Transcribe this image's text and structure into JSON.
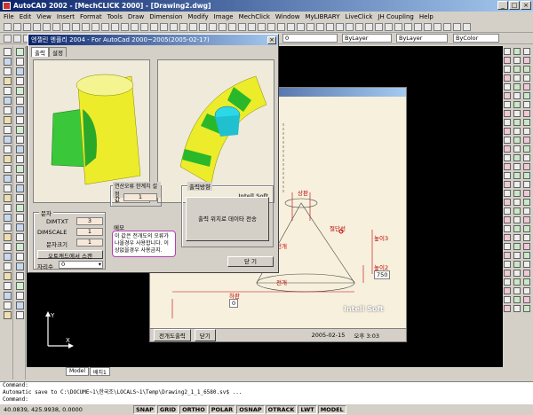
{
  "window": {
    "title": "AutoCAD 2002 - [MechCLICK 2000] - [Drawing2.dwg]"
  },
  "menu": [
    "File",
    "Edit",
    "View",
    "Insert",
    "Format",
    "Tools",
    "Draw",
    "Dimension",
    "Modify",
    "Image",
    "MechClick",
    "Window",
    "MyLIBRARY",
    "LiveClick",
    "JH Coupling",
    "Help"
  ],
  "toolbar": {
    "layer_value": "0",
    "color_value": "ByLayer",
    "linetype_value": "ByLayer",
    "lineweight_value": "ByColor"
  },
  "dialog": {
    "title": "엔젤린 엔플리 2004 - For AutoCad 2000~2005(2005-02-17)",
    "tabs": [
      "출력",
      "설정"
    ],
    "brand1": "Intell Soft",
    "brand2": "Intell Soft",
    "dim_group": "문자",
    "dimtxt_label": "DIMTXT",
    "dimtxt_value": "3",
    "dimscale_label": "DIMSCALE",
    "dimscale_value": "1",
    "textsize_label": "문자크기",
    "textsize_value": "1",
    "autocad_button": "오토캐드에서 스캔",
    "decimal_label": "자리수",
    "decimal_value": "0",
    "limit_group": "연산오류 한계치 설정",
    "limit_label": "값",
    "limit_value": "1",
    "memo_group": "메모",
    "memo_text": "이 값은 전개도의 오류가 나올경우 사용합니다. 이상없을경우 사용금지.",
    "output_group": "출력방향",
    "output_button": "출력 위치로 데이타 전송",
    "close_button": "닫 기"
  },
  "bgwindow": {
    "labels": {
      "half": "높이2",
      "dim_a": "높이3",
      "dim_b": "높이2",
      "dim_c": "하판",
      "cut_label": "절단선",
      "unfold1": "전개",
      "unfold2": "전개",
      "top": "상판"
    },
    "values": {
      "v1": "750",
      "v2": "0",
      "v3": "0"
    },
    "brand": "Intell Soft",
    "footer_btn1": "전개도출력",
    "footer_btn2": "닫기",
    "date": "2005-02-15",
    "time": "오후 3:03"
  },
  "model_tabs": [
    "Model",
    "배치1"
  ],
  "command": {
    "line1": "Command:",
    "line2": "Automatic save to C:\\DOCUME~1\\한국조\\LOCALS~1\\Temp\\Drawing2_1_1_6580.sv$ ...",
    "line3": "Command:"
  },
  "status": {
    "coords": "40.0839, 425.9938, 0.0000",
    "modes": [
      "SNAP",
      "GRID",
      "ORTHO",
      "POLAR",
      "OSNAP",
      "OTRACK",
      "LWT",
      "MODEL"
    ]
  },
  "colors": {
    "title_start": "#0a246a",
    "title_end": "#a6caf0",
    "dialog": "#d4d0c8",
    "canvas": "#000000"
  }
}
